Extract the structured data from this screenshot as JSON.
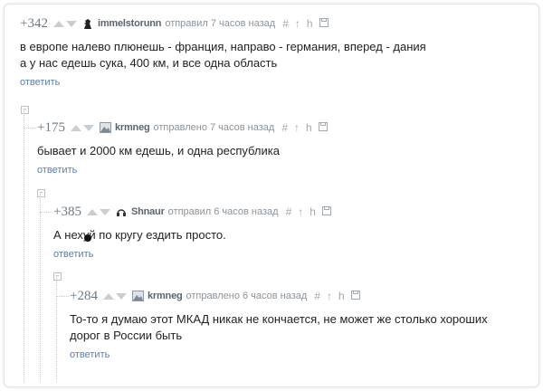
{
  "comments": [
    {
      "rating": "+342",
      "author": "immelstorunn",
      "meta": "отправил 7 часов назад",
      "text": "в европе налево плюнешь - франция, направо - германия, вперед - дания\nа у нас едешь сука, 400 км, и все одна область",
      "reply": "ответить",
      "avatar_icon": "chess-knight-icon"
    },
    {
      "rating": "+175",
      "author": "krmneg",
      "meta": "отправлено 7 часов назад",
      "text": "бывает и 2000 км едешь, и одна республика",
      "reply": "ответить",
      "avatar_icon": "image-avatar-icon"
    },
    {
      "rating": "+385",
      "author": "Shnaur",
      "meta": "отправил 6 часов назад",
      "text": "А нехуй по кругу ездить просто.",
      "reply": "ответить",
      "avatar_icon": "headphones-icon"
    },
    {
      "rating": "+284",
      "author": "krmneg",
      "meta": "отправлено 6 часов назад",
      "text": "То-то я думаю этот МКАД никак не кончается, не может же столько хороших\nдорог в России быть",
      "reply": "ответить",
      "avatar_icon": "image-avatar-icon"
    }
  ],
  "tools": [
    "#",
    "↑",
    "h",
    "save"
  ],
  "collapse_glyph": "⊟",
  "colors": {
    "rating": "#6b7a86",
    "reply_link": "#5a7fa8",
    "meta": "#8a949c"
  }
}
